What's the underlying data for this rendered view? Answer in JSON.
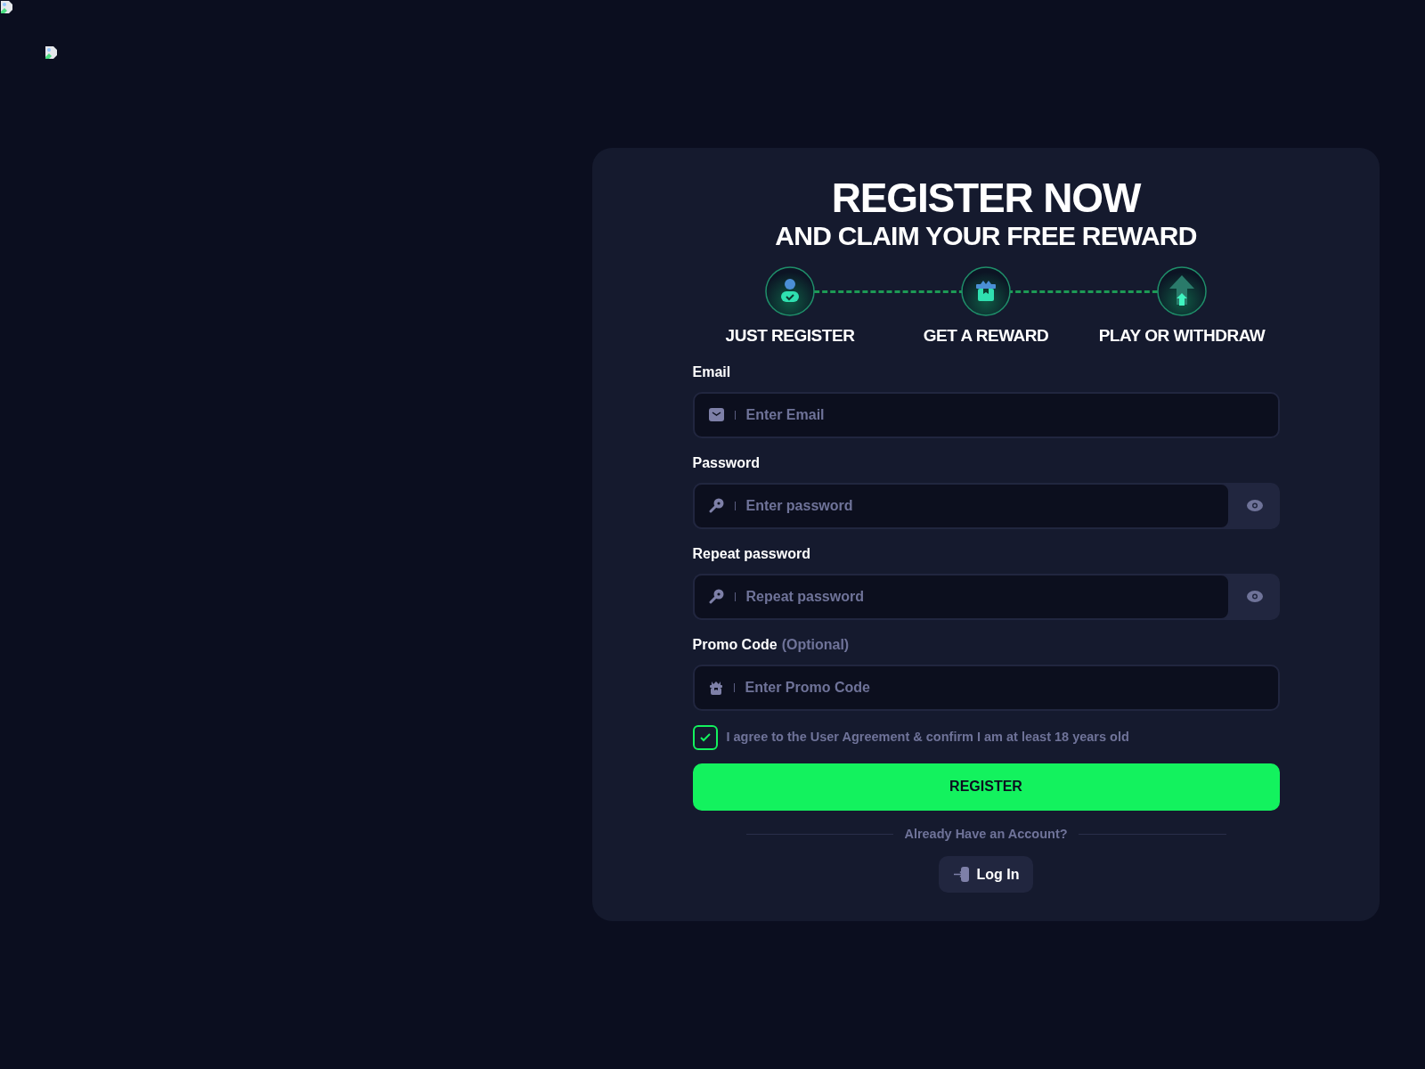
{
  "title": "REGISTER NOW",
  "subtitle": "AND CLAIM YOUR FREE REWARD",
  "steps": [
    {
      "kind": "user",
      "label": "JUST REGISTER"
    },
    {
      "kind": "gift",
      "label": "GET A REWARD"
    },
    {
      "kind": "arrow",
      "label": "PLAY OR WITHDRAW"
    }
  ],
  "fields": [
    {
      "kind": "email",
      "label": "Email",
      "placeholder": "Enter Email",
      "reveal": false
    },
    {
      "kind": "key",
      "label": "Password",
      "placeholder": "Enter password",
      "reveal": true
    },
    {
      "kind": "key",
      "label": "Repeat password",
      "placeholder": "Repeat password",
      "reveal": true
    },
    {
      "kind": "gift",
      "label": "Promo Code",
      "note": "(Optional)",
      "placeholder": "Enter Promo Code",
      "reveal": false
    }
  ],
  "agreement": {
    "text": "I agree to the User Agreement & confirm I am at least 18 years old",
    "checked": true
  },
  "register_button": "REGISTER",
  "login_prompt": "Already Have an Account?",
  "login_button": "Log In"
}
